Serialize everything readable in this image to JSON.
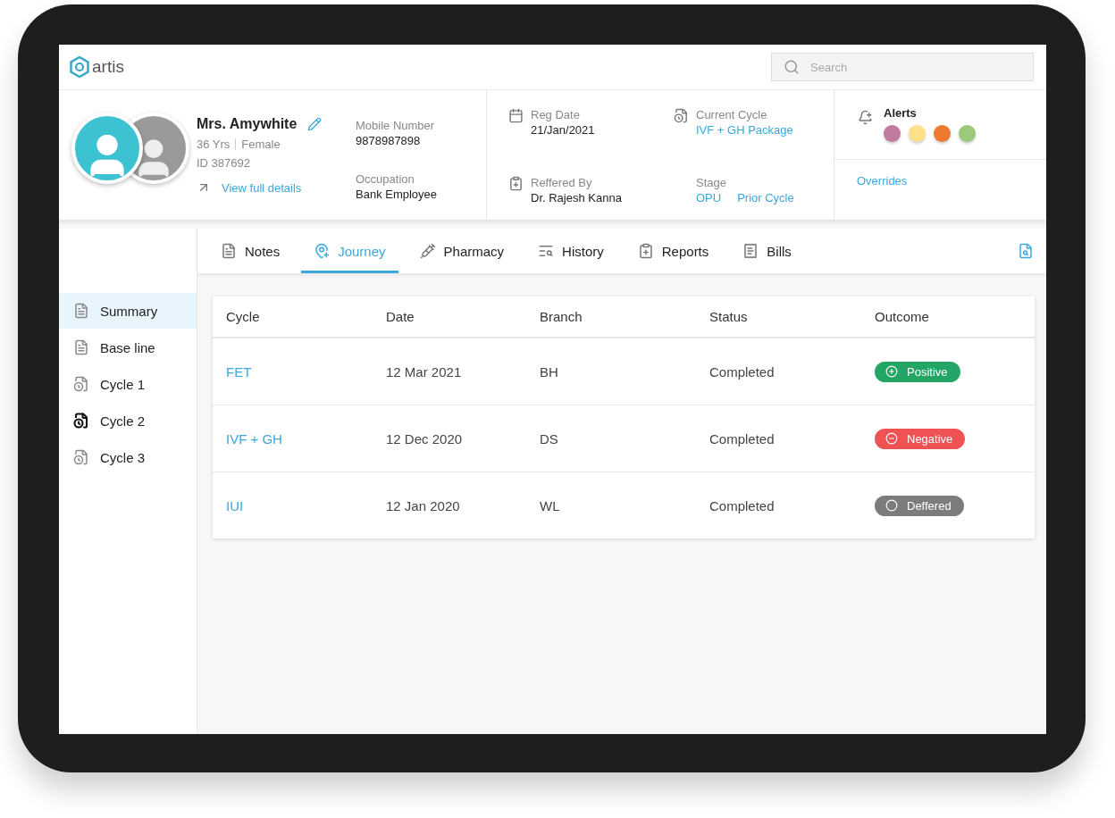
{
  "app": {
    "logo": "artis",
    "search": {
      "placeholder": "Search"
    }
  },
  "patient": {
    "name": "Mrs. Amywhite",
    "age": "36 Yrs",
    "gender": "Female",
    "id": "ID 387692",
    "details_link": "View full details",
    "mobile": {
      "label": "Mobile Number",
      "value": "9878987898"
    },
    "occupation": {
      "label": "Occupation",
      "value": "Bank Employee"
    },
    "reg_date": {
      "label": "Reg Date",
      "value": "21/Jan/2021"
    },
    "current_cycle": {
      "label": "Current Cycle",
      "value": "IVF + GH Package"
    },
    "referred_by": {
      "label": "Reffered By",
      "value": "Dr. Rajesh Kanna"
    },
    "stage": {
      "label": "Stage",
      "values": [
        "OPU",
        "Prior Cycle"
      ]
    },
    "alerts": {
      "label": "Alerts",
      "dots": [
        {
          "color": "#c27ba0"
        },
        {
          "color": "#ffe08a"
        },
        {
          "color": "#ee7a30"
        },
        {
          "color": "#9cc97a"
        }
      ]
    },
    "overrides": "Overrides"
  },
  "tabs": [
    {
      "label": "Notes",
      "kind": "notes",
      "selected": false
    },
    {
      "label": "Journey",
      "kind": "journey",
      "selected": true
    },
    {
      "label": "Pharmacy",
      "kind": "pharmacy",
      "selected": false
    },
    {
      "label": "History",
      "kind": "history",
      "selected": false
    },
    {
      "label": "Reports",
      "kind": "reports",
      "selected": false
    },
    {
      "label": "Bills",
      "kind": "bills",
      "selected": false
    }
  ],
  "sidebar": {
    "items": [
      {
        "label": "Summary",
        "kind": "document",
        "selected": true,
        "current": false
      },
      {
        "label": "Base line",
        "kind": "document",
        "selected": false,
        "current": false
      },
      {
        "label": "Cycle 1",
        "kind": "cycle",
        "selected": false,
        "current": false
      },
      {
        "label": "Cycle 2",
        "kind": "cycle",
        "selected": false,
        "current": true
      },
      {
        "label": "Cycle 3",
        "kind": "cycle",
        "selected": false,
        "current": false
      }
    ]
  },
  "table": {
    "columns": [
      "Cycle",
      "Date",
      "Branch",
      "Status",
      "Outcome"
    ],
    "rows": [
      {
        "cycle": "FET",
        "date": "12 Mar 2021",
        "branch": "BH",
        "status": "Completed",
        "outcome": {
          "label": "Positive",
          "kind": "positive"
        }
      },
      {
        "cycle": "IVF + GH",
        "date": "12 Dec 2020",
        "branch": "DS",
        "status": "Completed",
        "outcome": {
          "label": "Negative",
          "kind": "negative"
        }
      },
      {
        "cycle": "IUI",
        "date": "12 Jan 2020",
        "branch": "WL",
        "status": "Completed",
        "outcome": {
          "label": "Deffered",
          "kind": "deferred"
        }
      }
    ]
  }
}
